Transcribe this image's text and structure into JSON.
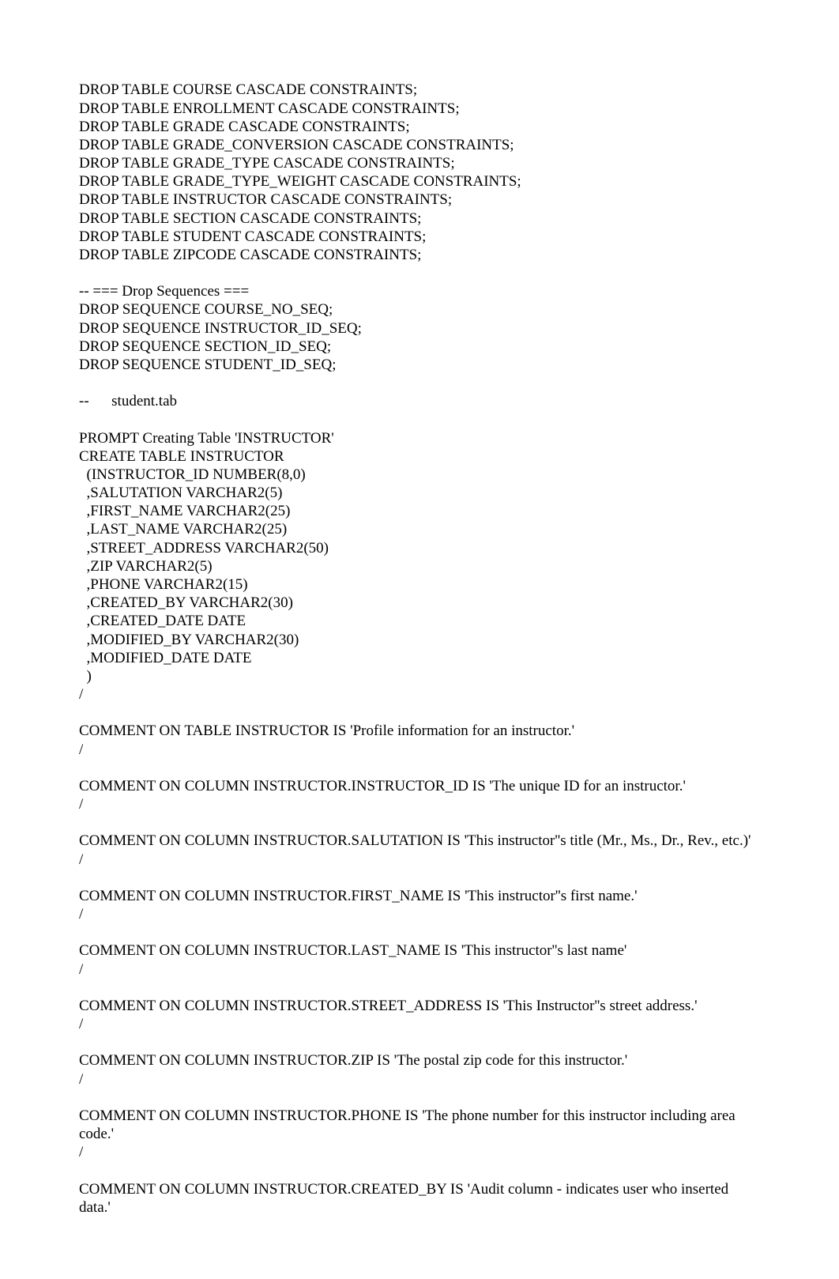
{
  "lines": [
    "DROP TABLE COURSE CASCADE CONSTRAINTS;",
    "DROP TABLE ENROLLMENT CASCADE CONSTRAINTS;",
    "DROP TABLE GRADE CASCADE CONSTRAINTS;",
    "DROP TABLE GRADE_CONVERSION CASCADE CONSTRAINTS;",
    "DROP TABLE GRADE_TYPE CASCADE CONSTRAINTS;",
    "DROP TABLE GRADE_TYPE_WEIGHT CASCADE CONSTRAINTS;",
    "DROP TABLE INSTRUCTOR CASCADE CONSTRAINTS;",
    "DROP TABLE SECTION CASCADE CONSTRAINTS;",
    "DROP TABLE STUDENT CASCADE CONSTRAINTS;",
    "DROP TABLE ZIPCODE CASCADE CONSTRAINTS;",
    "",
    "-- === Drop Sequences ===",
    "DROP SEQUENCE COURSE_NO_SEQ;",
    "DROP SEQUENCE INSTRUCTOR_ID_SEQ;",
    "DROP SEQUENCE SECTION_ID_SEQ;",
    "DROP SEQUENCE STUDENT_ID_SEQ;",
    "",
    "--      student.tab",
    "",
    "PROMPT Creating Table 'INSTRUCTOR'",
    "CREATE TABLE INSTRUCTOR",
    "  (INSTRUCTOR_ID NUMBER(8,0)",
    "  ,SALUTATION VARCHAR2(5)",
    "  ,FIRST_NAME VARCHAR2(25)",
    "  ,LAST_NAME VARCHAR2(25)",
    "  ,STREET_ADDRESS VARCHAR2(50)",
    "  ,ZIP VARCHAR2(5)",
    "  ,PHONE VARCHAR2(15)",
    "  ,CREATED_BY VARCHAR2(30)",
    "  ,CREATED_DATE DATE",
    "  ,MODIFIED_BY VARCHAR2(30)",
    "  ,MODIFIED_DATE DATE",
    "  )",
    "/",
    "",
    "COMMENT ON TABLE INSTRUCTOR IS 'Profile information for an instructor.'",
    "/",
    "",
    "COMMENT ON COLUMN INSTRUCTOR.INSTRUCTOR_ID IS 'The unique ID for an instructor.'",
    "/",
    "",
    "COMMENT ON COLUMN INSTRUCTOR.SALUTATION IS 'This instructor''s title (Mr., Ms., Dr., Rev., etc.)'",
    "/",
    "",
    "COMMENT ON COLUMN INSTRUCTOR.FIRST_NAME IS 'This instructor''s first name.'",
    "/",
    "",
    "COMMENT ON COLUMN INSTRUCTOR.LAST_NAME IS 'This instructor''s last name'",
    "/",
    "",
    "COMMENT ON COLUMN INSTRUCTOR.STREET_ADDRESS IS 'This Instructor''s street address.'",
    "/",
    "",
    "COMMENT ON COLUMN INSTRUCTOR.ZIP IS 'The postal zip code for this instructor.'",
    "/",
    "",
    "COMMENT ON COLUMN INSTRUCTOR.PHONE IS 'The phone number for this instructor including area code.'",
    "/",
    "",
    "COMMENT ON COLUMN INSTRUCTOR.CREATED_BY IS 'Audit column - indicates user who inserted data.'"
  ]
}
